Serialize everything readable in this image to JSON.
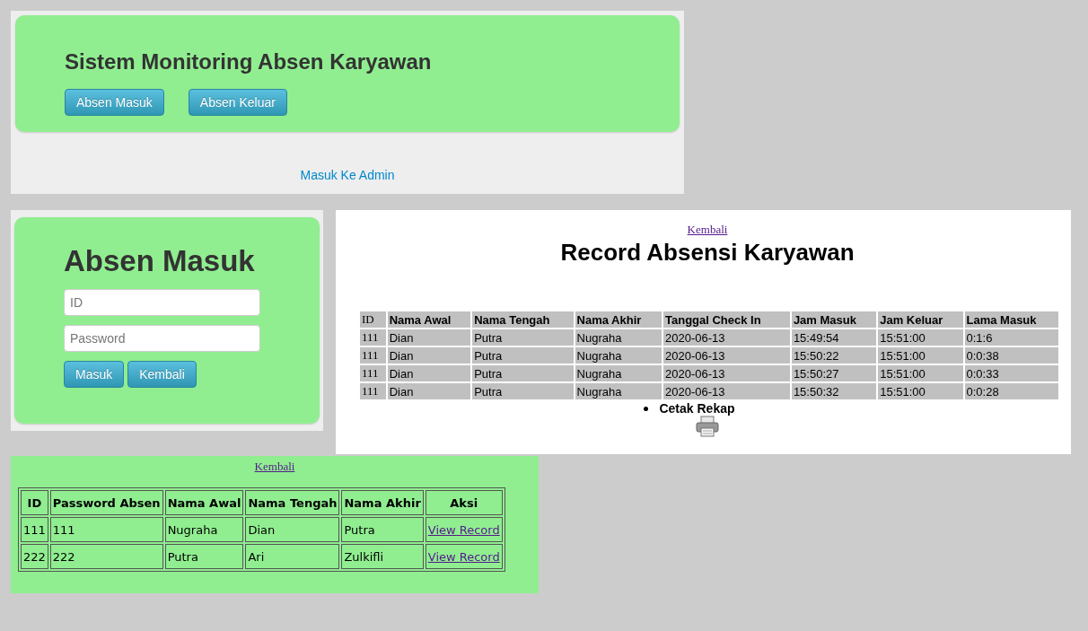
{
  "home_panel": {
    "title": "Sistem Monitoring Absen Karyawan",
    "buttons": [
      "Absen Masuk",
      "Absen Keluar"
    ],
    "admin_link": "Masuk Ke Admin"
  },
  "login_panel": {
    "title": "Absen Masuk",
    "fields": [
      {
        "placeholder": "ID"
      },
      {
        "placeholder": "Password"
      }
    ],
    "buttons": [
      "Masuk",
      "Kembali"
    ]
  },
  "record_panel": {
    "back_link": "Kembali",
    "title": "Record Absensi Karyawan",
    "table": {
      "columns": [
        "ID",
        "Nama Awal",
        "Nama Tengah",
        "Nama Akhir",
        "Tanggal Check In",
        "Jam Masuk",
        "Jam Keluar",
        "Lama Masuk"
      ],
      "rows": [
        [
          "111",
          "Dian",
          "Putra",
          "Nugraha",
          "2020-06-13",
          "15:49:54",
          "15:51:00",
          "0:1:6"
        ],
        [
          "111",
          "Dian",
          "Putra",
          "Nugraha",
          "2020-06-13",
          "15:50:22",
          "15:51:00",
          "0:0:38"
        ],
        [
          "111",
          "Dian",
          "Putra",
          "Nugraha",
          "2020-06-13",
          "15:50:27",
          "15:51:00",
          "0:0:33"
        ],
        [
          "111",
          "Dian",
          "Putra",
          "Nugraha",
          "2020-06-13",
          "15:50:32",
          "15:51:00",
          "0:0:28"
        ]
      ]
    },
    "print_item": "Cetak Rekap"
  },
  "admin_panel": {
    "back_link": "Kembali",
    "table": {
      "columns": [
        "ID",
        "Password Absen",
        "Nama Awal",
        "Nama Tengah",
        "Nama Akhir",
        "Aksi"
      ],
      "rows": [
        {
          "cells": [
            "111",
            "111",
            "Nugraha",
            "Dian",
            "Putra"
          ],
          "action": "View Record"
        },
        {
          "cells": [
            "222",
            "222",
            "Putra",
            "Ari",
            "Zulkifli"
          ],
          "action": "View Record"
        }
      ]
    }
  }
}
